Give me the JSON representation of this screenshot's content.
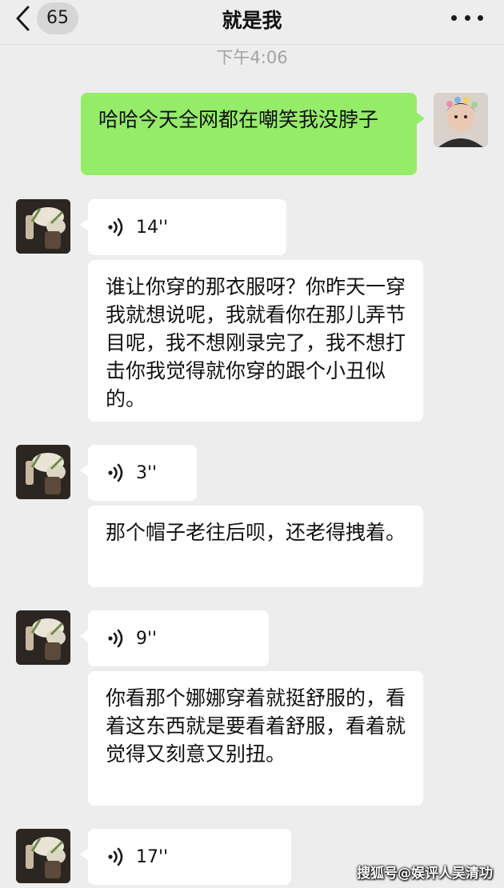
{
  "header": {
    "back_icon": "chevron-left-icon",
    "unread_count": "65",
    "title": "就是我",
    "more_icon": "more-dots-icon"
  },
  "timestamp": "下午4:06",
  "messages": [
    {
      "sender": "me",
      "type": "text",
      "text": "哈哈今天全网都在嘲笑我没脖子"
    },
    {
      "sender": "other",
      "type": "voice",
      "duration": "14''"
    },
    {
      "sender": "other",
      "type": "text",
      "text": "谁让你穿的那衣服呀？你昨天一穿我就想说呢，我就看你在那儿弄节目呢，我不想刚录完了，我不想打击你我觉得就你穿的跟个小丑似的。"
    },
    {
      "sender": "other",
      "type": "voice",
      "duration": "3''"
    },
    {
      "sender": "other",
      "type": "text",
      "text": "那个帽子老往后呗，还老得拽着。"
    },
    {
      "sender": "other",
      "type": "voice",
      "duration": "9''"
    },
    {
      "sender": "other",
      "type": "text",
      "text": "你看那个娜娜穿着就挺舒服的，看着这东西就是要看着舒服，看着就觉得又刻意又别扭。"
    },
    {
      "sender": "other",
      "type": "voice",
      "duration": "17''"
    }
  ],
  "watermark": "搜狐号@娱评人吴清功",
  "colors": {
    "background": "#ededed",
    "my_bubble": "#95ec69",
    "other_bubble": "#ffffff",
    "timestamp": "#a3a3a3"
  },
  "icons": {
    "voice": "voice-wave-icon"
  }
}
